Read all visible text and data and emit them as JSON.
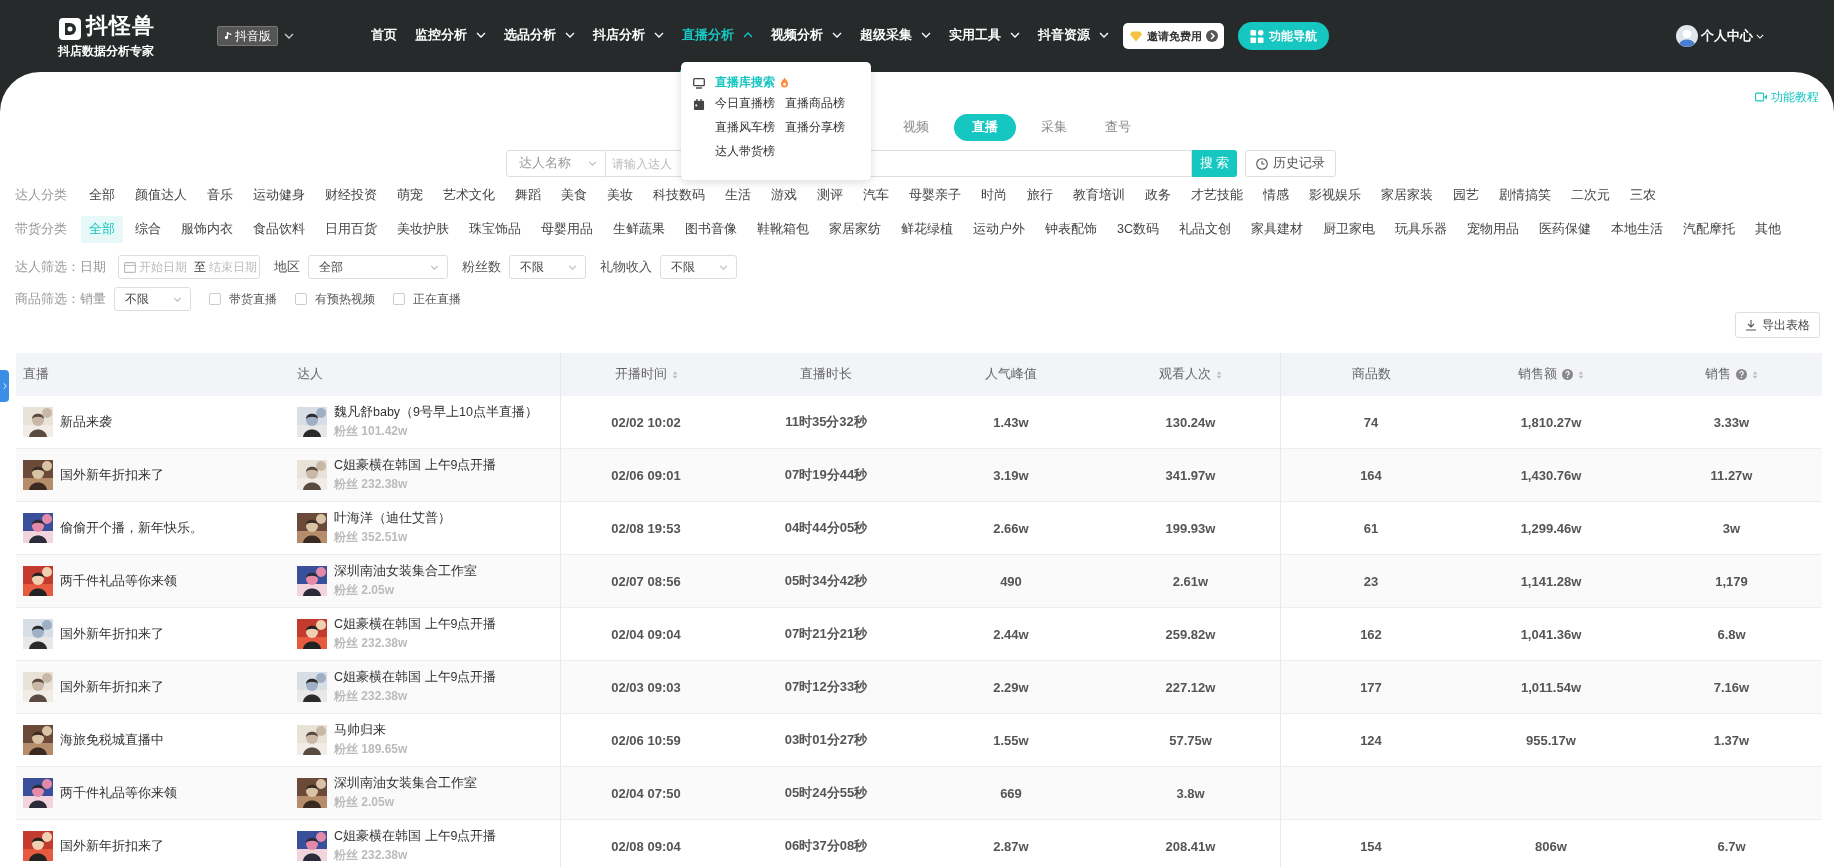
{
  "header": {
    "logo_title": "抖怪兽",
    "logo_subtitle": "抖店数据分析专家",
    "platform_select": "抖音版",
    "nav": [
      {
        "label": "首页",
        "dropdown": false,
        "selected": false
      },
      {
        "label": "监控分析",
        "dropdown": true,
        "selected": false
      },
      {
        "label": "选品分析",
        "dropdown": true,
        "selected": false
      },
      {
        "label": "抖店分析",
        "dropdown": true,
        "selected": false
      },
      {
        "label": "直播分析",
        "dropdown": true,
        "selected": true
      },
      {
        "label": "视频分析",
        "dropdown": true,
        "selected": false
      },
      {
        "label": "超级采集",
        "dropdown": true,
        "selected": false
      },
      {
        "label": "实用工具",
        "dropdown": true,
        "selected": false
      },
      {
        "label": "抖音资源",
        "dropdown": true,
        "selected": false
      }
    ],
    "invite_button": "邀请免费用",
    "feature_nav_button": "功能导航",
    "user_menu": "个人中心"
  },
  "nav_dropdown": [
    {
      "items": [
        {
          "label": "直播库搜索",
          "selected": true,
          "hot": true
        }
      ]
    },
    {
      "items": [
        {
          "label": "今日直播榜",
          "selected": false,
          "hot": false
        },
        {
          "label": "直播商品榜",
          "selected": false,
          "hot": false
        },
        {
          "label": "直播风车榜",
          "selected": false,
          "hot": false
        },
        {
          "label": "直播分享榜",
          "selected": false,
          "hot": false
        },
        {
          "label": "达人带货榜",
          "selected": false,
          "hot": false
        }
      ]
    }
  ],
  "tutorial_link": "功能教程",
  "search_tabs": [
    {
      "label": "视频",
      "selected": false
    },
    {
      "label": "直播",
      "selected": true
    },
    {
      "label": "采集",
      "selected": false
    },
    {
      "label": "查号",
      "selected": false
    }
  ],
  "search": {
    "type_select": "达人名称",
    "placeholder": "请输入达人",
    "button": "搜 索",
    "history_button": "历史记录"
  },
  "category_rows": [
    {
      "label": "达人分类",
      "items": [
        {
          "label": "全部",
          "selected": false
        },
        {
          "label": "颜值达人",
          "selected": false
        },
        {
          "label": "音乐",
          "selected": false
        },
        {
          "label": "运动健身",
          "selected": false
        },
        {
          "label": "财经投资",
          "selected": false
        },
        {
          "label": "萌宠",
          "selected": false
        },
        {
          "label": "艺术文化",
          "selected": false
        },
        {
          "label": "舞蹈",
          "selected": false
        },
        {
          "label": "美食",
          "selected": false
        },
        {
          "label": "美妆",
          "selected": false
        },
        {
          "label": "科技数码",
          "selected": false
        },
        {
          "label": "生活",
          "selected": false
        },
        {
          "label": "游戏",
          "selected": false
        },
        {
          "label": "测评",
          "selected": false
        },
        {
          "label": "汽车",
          "selected": false
        },
        {
          "label": "母婴亲子",
          "selected": false
        },
        {
          "label": "时尚",
          "selected": false
        },
        {
          "label": "旅行",
          "selected": false
        },
        {
          "label": "教育培训",
          "selected": false
        },
        {
          "label": "政务",
          "selected": false
        },
        {
          "label": "才艺技能",
          "selected": false
        },
        {
          "label": "情感",
          "selected": false
        },
        {
          "label": "影视娱乐",
          "selected": false
        },
        {
          "label": "家居家装",
          "selected": false
        },
        {
          "label": "园艺",
          "selected": false
        },
        {
          "label": "剧情搞笑",
          "selected": false
        },
        {
          "label": "二次元",
          "selected": false
        },
        {
          "label": "三农",
          "selected": false
        }
      ]
    },
    {
      "label": "带货分类",
      "items": [
        {
          "label": "全部",
          "selected": true
        },
        {
          "label": "综合",
          "selected": false
        },
        {
          "label": "服饰内衣",
          "selected": false
        },
        {
          "label": "食品饮料",
          "selected": false
        },
        {
          "label": "日用百货",
          "selected": false
        },
        {
          "label": "美妆护肤",
          "selected": false
        },
        {
          "label": "珠宝饰品",
          "selected": false
        },
        {
          "label": "母婴用品",
          "selected": false
        },
        {
          "label": "生鲜蔬果",
          "selected": false
        },
        {
          "label": "图书音像",
          "selected": false
        },
        {
          "label": "鞋靴箱包",
          "selected": false
        },
        {
          "label": "家居家纺",
          "selected": false
        },
        {
          "label": "鲜花绿植",
          "selected": false
        },
        {
          "label": "运动户外",
          "selected": false
        },
        {
          "label": "钟表配饰",
          "selected": false
        },
        {
          "label": "3C数码",
          "selected": false
        },
        {
          "label": "礼品文创",
          "selected": false
        },
        {
          "label": "家具建材",
          "selected": false
        },
        {
          "label": "厨卫家电",
          "selected": false
        },
        {
          "label": "玩具乐器",
          "selected": false
        },
        {
          "label": "宠物用品",
          "selected": false
        },
        {
          "label": "医药保健",
          "selected": false
        },
        {
          "label": "本地生活",
          "selected": false
        },
        {
          "label": "汽配摩托",
          "selected": false
        },
        {
          "label": "其他",
          "selected": false
        }
      ]
    }
  ],
  "influencer_filter": {
    "label": "达人筛选：日期",
    "date_start_placeholder": "开始日期",
    "date_separator": "至",
    "date_end_placeholder": "结束日期",
    "region_label": "地区",
    "region_value": "全部",
    "fans_label": "粉丝数",
    "fans_value": "不限",
    "gift_label": "礼物收入",
    "gift_value": "不限"
  },
  "product_filter": {
    "label": "商品筛选：销量",
    "sales_value": "不限",
    "checkboxes": [
      {
        "label": "带货直播",
        "checked": false
      },
      {
        "label": "有预热视频",
        "checked": false
      },
      {
        "label": "正在直播",
        "checked": false
      }
    ]
  },
  "export_button": "导出表格",
  "table": {
    "columns": [
      {
        "label": "直播",
        "sortable": false,
        "help": false
      },
      {
        "label": "达人",
        "sortable": false,
        "help": false
      },
      {
        "label": "开播时间",
        "sortable": true,
        "help": false
      },
      {
        "label": "直播时长",
        "sortable": false,
        "help": false
      },
      {
        "label": "人气峰值",
        "sortable": false,
        "help": false
      },
      {
        "label": "观看人次",
        "sortable": true,
        "help": false
      },
      {
        "label": "商品数",
        "sortable": false,
        "help": false
      },
      {
        "label": "销售额",
        "sortable": true,
        "help": true
      },
      {
        "label": "销售",
        "sortable": true,
        "help": true
      }
    ],
    "rows": [
      {
        "title": "新品来袭",
        "streamer": "魏凡舒baby（9号早上10点半直播）",
        "fans": "粉丝 101.42w",
        "start": "02/02 10:02",
        "duration": "11时35分32秒",
        "peak": "1.43w",
        "views": "130.24w",
        "products": "74",
        "sales_amount": "1,810.27w",
        "sales": "3.33w"
      },
      {
        "title": "国外新年折扣来了",
        "streamer": "C姐豪横在韩国 上午9点开播",
        "fans": "粉丝 232.38w",
        "start": "02/06 09:01",
        "duration": "07时19分44秒",
        "peak": "3.19w",
        "views": "341.97w",
        "products": "164",
        "sales_amount": "1,430.76w",
        "sales": "11.27w"
      },
      {
        "title": "偷偷开个播，新年快乐。",
        "streamer": "叶海洋（迪仕艾普）",
        "fans": "粉丝 352.51w",
        "start": "02/08 19:53",
        "duration": "04时44分05秒",
        "peak": "2.66w",
        "views": "199.93w",
        "products": "61",
        "sales_amount": "1,299.46w",
        "sales": "3w"
      },
      {
        "title": "两千件礼品等你来领",
        "streamer": "深圳南油女装集合工作室",
        "fans": "粉丝 2.05w",
        "start": "02/07 08:56",
        "duration": "05时34分42秒",
        "peak": "490",
        "views": "2.61w",
        "products": "23",
        "sales_amount": "1,141.28w",
        "sales": "1,179"
      },
      {
        "title": "国外新年折扣来了",
        "streamer": "C姐豪横在韩国 上午9点开播",
        "fans": "粉丝 232.38w",
        "start": "02/04 09:04",
        "duration": "07时21分21秒",
        "peak": "2.44w",
        "views": "259.82w",
        "products": "162",
        "sales_amount": "1,041.36w",
        "sales": "6.8w"
      },
      {
        "title": "国外新年折扣来了",
        "streamer": "C姐豪横在韩国 上午9点开播",
        "fans": "粉丝 232.38w",
        "start": "02/03 09:03",
        "duration": "07时12分33秒",
        "peak": "2.29w",
        "views": "227.12w",
        "products": "177",
        "sales_amount": "1,011.54w",
        "sales": "7.16w"
      },
      {
        "title": "海旅免税城直播中",
        "streamer": "马帅归来",
        "fans": "粉丝 189.65w",
        "start": "02/06 10:59",
        "duration": "03时01分27秒",
        "peak": "1.55w",
        "views": "57.75w",
        "products": "124",
        "sales_amount": "955.17w",
        "sales": "1.37w"
      },
      {
        "title": "两千件礼品等你来领",
        "streamer": "深圳南油女装集合工作室",
        "fans": "粉丝 2.05w",
        "start": "02/04 07:50",
        "duration": "05时24分55秒",
        "peak": "669",
        "views": "3.8w"
      },
      {
        "title": "国外新年折扣来了",
        "streamer": "C姐豪横在韩国 上午9点开播",
        "fans": "粉丝 232.38w",
        "start": "02/08 09:04",
        "duration": "06时37分08秒",
        "peak": "2.87w",
        "views": "208.41w",
        "products": "154",
        "sales_amount": "806w",
        "sales": "6.7w"
      }
    ]
  }
}
